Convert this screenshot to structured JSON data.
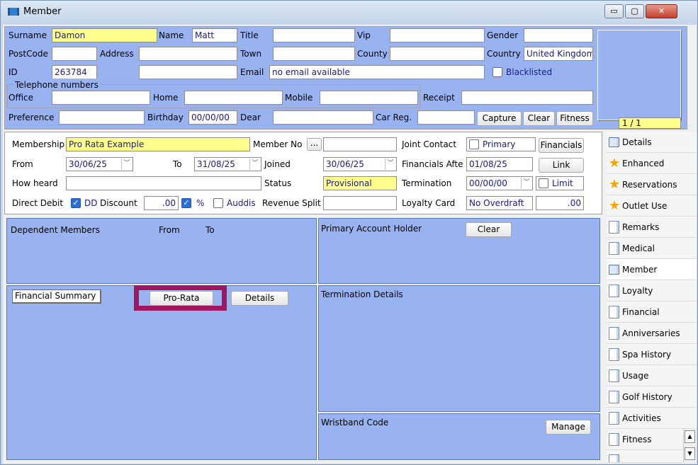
{
  "window": {
    "title": "Member",
    "min": "▭",
    "max": "▢",
    "close": "✕"
  },
  "top": {
    "surname_label": "Surname",
    "surname": "Damon",
    "name_label": "Name",
    "name": "Matt",
    "title_label": "Title",
    "title": "",
    "vip_label": "Vip",
    "vip": "",
    "gender_label": "Gender",
    "gender": "",
    "postcode_label": "PostCode",
    "postcode": "",
    "address_label": "Address",
    "address1": "",
    "address2": "",
    "town_label": "Town",
    "town": "",
    "county_label": "County",
    "county": "",
    "country_label": "Country",
    "country": "United Kingdom",
    "id_label": "ID",
    "id": "263784",
    "email_label": "Email",
    "email": "no email available",
    "blacklisted_label": "Blacklisted",
    "tel_group": "Telephone numbers",
    "office_label": "Office",
    "home_label": "Home",
    "mobile_label": "Mobile",
    "receipt_label": "Receipt",
    "preference_label": "Preference",
    "birthday_label": "Birthday",
    "birthday": "00/00/00",
    "dear_label": "Dear",
    "carreg_label": "Car Reg.",
    "capture_btn": "Capture",
    "clear_btn": "Clear",
    "fitness_btn": "Fitness",
    "photo_counter": "1 / 1"
  },
  "membership": {
    "membership_label": "Membership",
    "membership": "Pro Rata Example",
    "memberno_label": "Member No",
    "memberno_btn": "...",
    "joint_label": "Joint Contact",
    "primary_label": "Primary",
    "financials_btn": "Financials",
    "from_label": "From",
    "from": "30/06/25",
    "to_label": "To",
    "to": "31/08/25",
    "joined_label": "Joined",
    "joined": "30/06/25",
    "fin_after_label": "Financials Afte",
    "fin_after": "01/08/25",
    "link_btn": "Link",
    "howheard_label": "How heard",
    "status_label": "Status",
    "status": "Provisional",
    "termination_label": "Termination",
    "termination": "00/00/00",
    "limit_label": "Limit",
    "dd_label": "Direct Debit",
    "dd_check": "DD",
    "discount_label": "Discount",
    "discount": ".00",
    "pct_label": "%",
    "auddis_label": "Auddis",
    "revsplit_label": "Revenue Split",
    "loyalty_label": "Loyalty Card",
    "loyalty": "No Overdraft",
    "loyalty_val": ".00"
  },
  "panels": {
    "dependents": "Dependent Members",
    "dep_from": "From",
    "dep_to": "To",
    "primary_holder": "Primary Account Holder",
    "primary_clear": "Clear",
    "fin_summary": "Financial Summary",
    "prorata_btn": "Pro-Rata",
    "details_btn": "Details",
    "termination_details": "Termination Details",
    "wristband": "Wristband Code",
    "manage_btn": "Manage"
  },
  "tabs": [
    "Details",
    "Enhanced",
    "Reservations",
    "Outlet Use",
    "Remarks",
    "Medical",
    "Member",
    "Loyalty",
    "Financial",
    "Anniversaries",
    "Spa History",
    "Usage",
    "Golf History",
    "Activities",
    "Fitness"
  ],
  "colors": {
    "highlight": "#a0175f",
    "field_yellow": "#ffff8c",
    "panel_blue": "#99b3f0"
  }
}
